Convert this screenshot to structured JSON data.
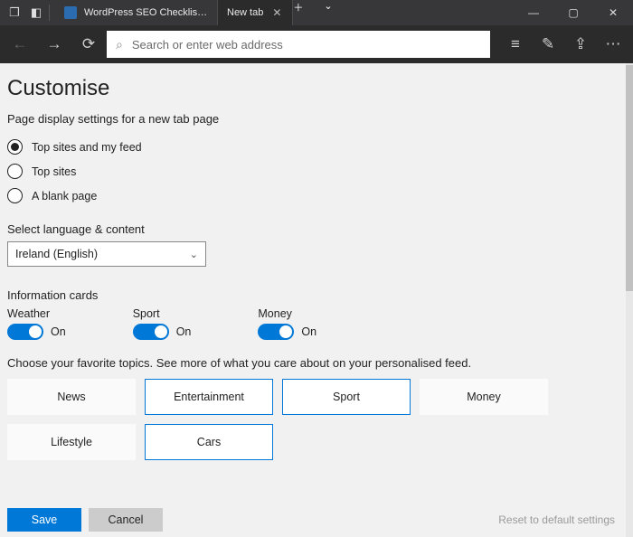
{
  "window": {
    "tabs": [
      {
        "label": "WordPress SEO Checklist - …",
        "active": false
      },
      {
        "label": "New tab",
        "active": true
      }
    ]
  },
  "toolbar": {
    "address_placeholder": "Search or enter web address"
  },
  "page": {
    "title": "Customise",
    "display_settings_label": "Page display settings for a new tab page",
    "radios": [
      {
        "label": "Top sites and my feed",
        "checked": true
      },
      {
        "label": "Top sites",
        "checked": false
      },
      {
        "label": "A blank page",
        "checked": false
      }
    ],
    "language_label": "Select language & content",
    "language_value": "Ireland (English)",
    "info_cards_label": "Information cards",
    "toggles": [
      {
        "name": "Weather",
        "state": "On"
      },
      {
        "name": "Sport",
        "state": "On"
      },
      {
        "name": "Money",
        "state": "On"
      }
    ],
    "topics_label": "Choose your favorite topics. See more of what you care about on your personalised feed.",
    "topics": [
      {
        "label": "News",
        "selected": false
      },
      {
        "label": "Entertainment",
        "selected": true
      },
      {
        "label": "Sport",
        "selected": true
      },
      {
        "label": "Money",
        "selected": false
      },
      {
        "label": "Lifestyle",
        "selected": false
      },
      {
        "label": "Cars",
        "selected": true
      }
    ],
    "save_label": "Save",
    "cancel_label": "Cancel",
    "reset_label": "Reset to default settings"
  }
}
